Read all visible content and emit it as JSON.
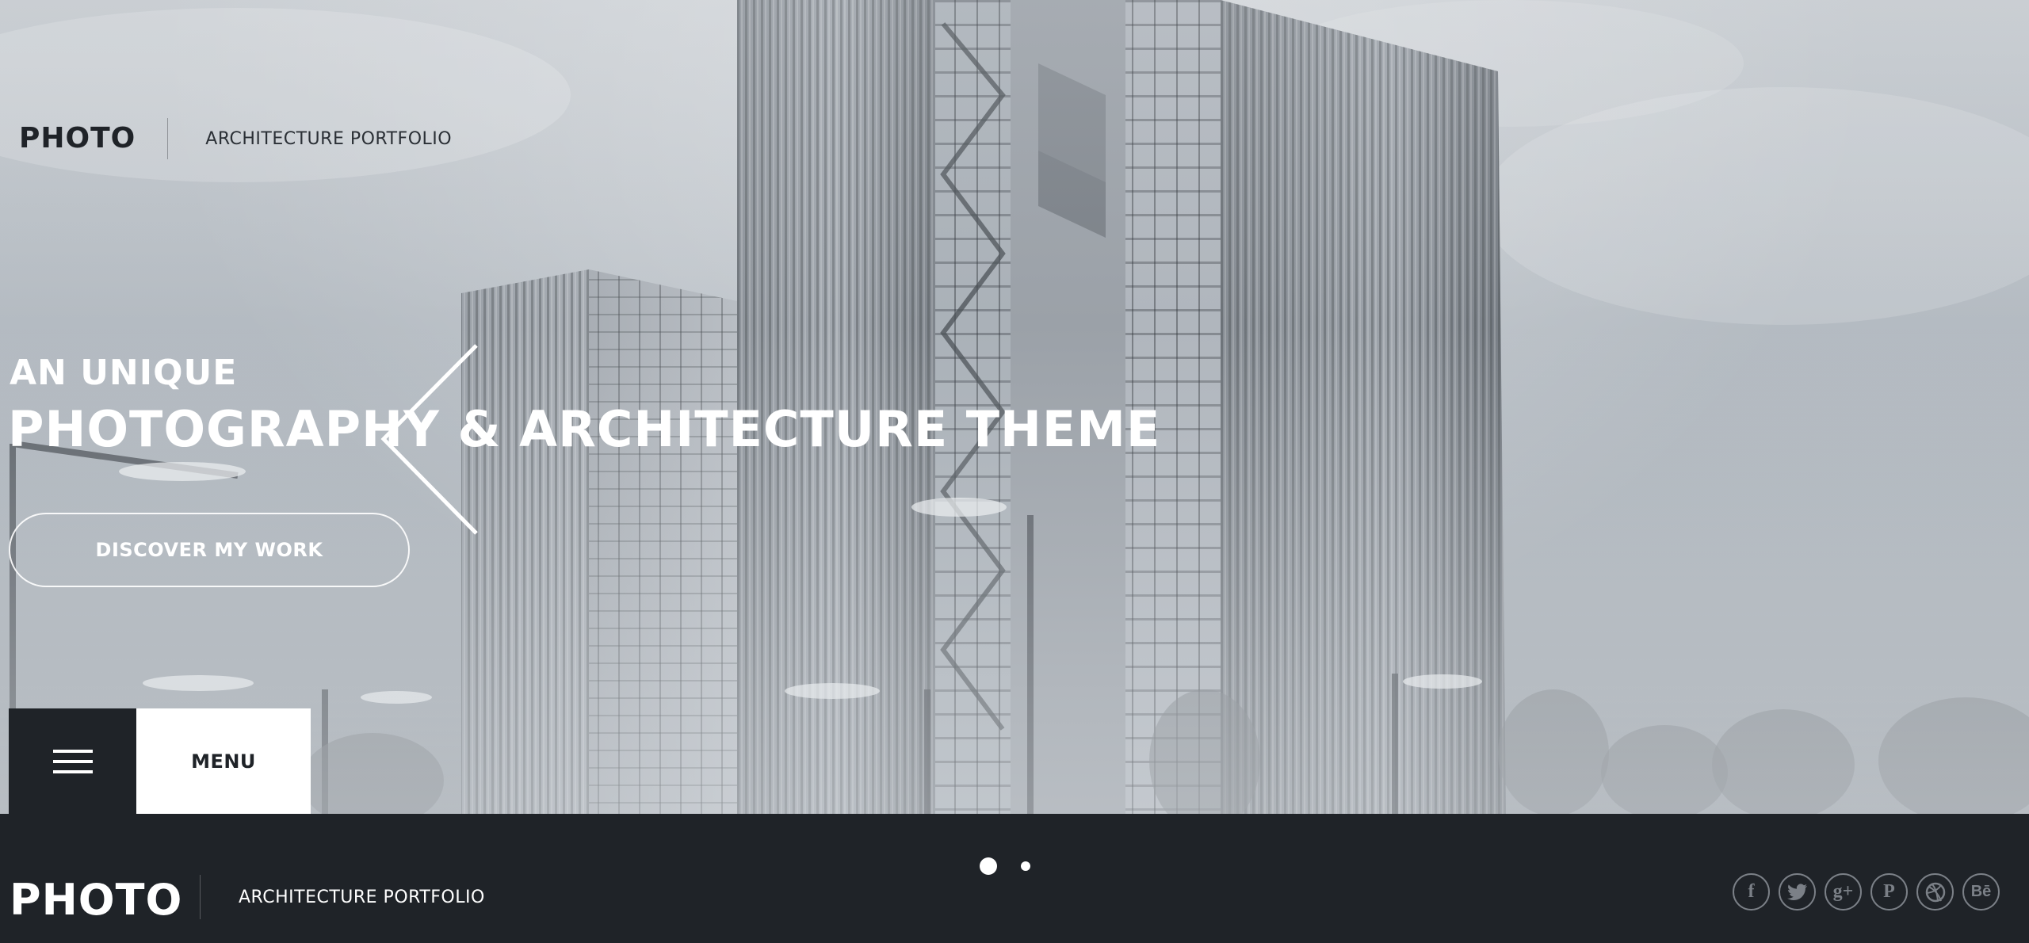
{
  "header": {
    "logo": "PHOTO",
    "tagline": "ARCHITECTURE PORTFOLIO"
  },
  "hero": {
    "subtitle": "AN UNIQUE",
    "title": "PHOTOGRAPHY & ARCHITECTURE THEME",
    "cta_label": "DISCOVER MY WORK"
  },
  "menu": {
    "label": "MENU",
    "icon": "hamburger-icon"
  },
  "slider": {
    "slide_count": 2,
    "active_slide": 1
  },
  "footer": {
    "logo": "PHOTO",
    "tagline": "ARCHITECTURE PORTFOLIO",
    "socials": [
      {
        "name": "facebook-icon",
        "glyph": "f"
      },
      {
        "name": "twitter-icon",
        "glyph": ""
      },
      {
        "name": "google-plus-icon",
        "glyph": "g+"
      },
      {
        "name": "pinterest-icon",
        "glyph": "P"
      },
      {
        "name": "dribbble-icon",
        "glyph": ""
      },
      {
        "name": "behance-icon",
        "glyph": "Bē"
      }
    ]
  },
  "colors": {
    "dark": "#1f2328",
    "white": "#ffffff",
    "social_icon": "#7b8087"
  }
}
